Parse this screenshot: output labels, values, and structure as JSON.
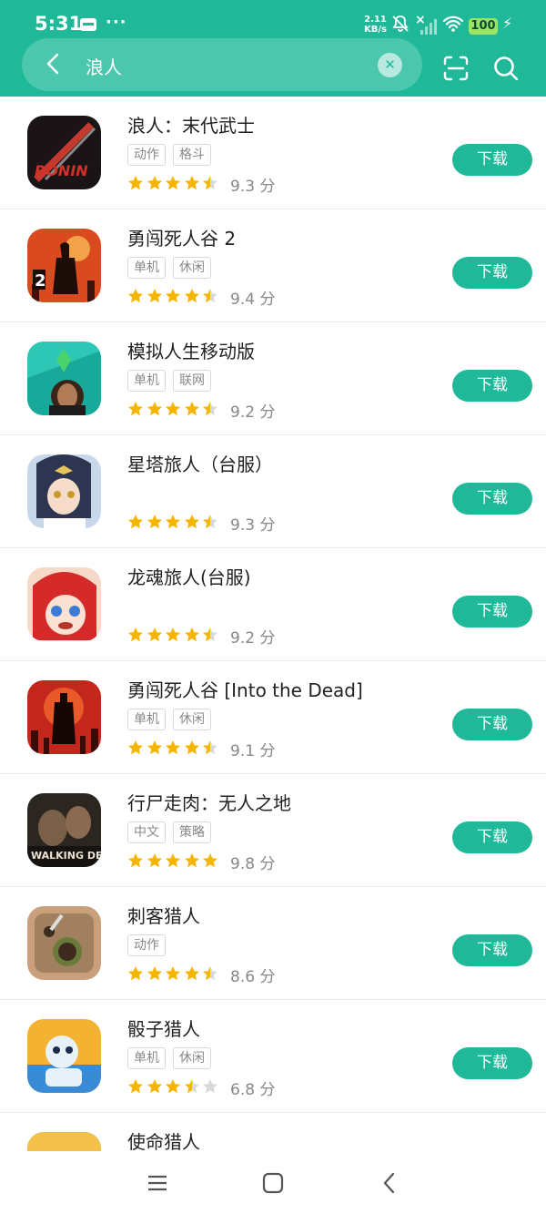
{
  "status": {
    "time": "5:31",
    "speed_value": "2.11",
    "speed_unit": "KB/s",
    "battery": "100"
  },
  "search": {
    "query": "浪人",
    "placeholder": ""
  },
  "accent": "#1fb99a",
  "download_label": "下载",
  "apps": [
    {
      "name": "浪人：末代武士",
      "tags": [
        "动作",
        "格斗"
      ],
      "rating": 4.5,
      "score": "9.3 分",
      "icon": "ronin-game-icon"
    },
    {
      "name": "勇闯死人谷 2",
      "tags": [
        "单机",
        "休闲"
      ],
      "rating": 4.5,
      "score": "9.4 分",
      "icon": "into-the-dead-2-icon"
    },
    {
      "name": "模拟人生移动版",
      "tags": [
        "单机",
        "联网"
      ],
      "rating": 4.5,
      "score": "9.2 分",
      "icon": "sims-mobile-icon"
    },
    {
      "name": "星塔旅人（台服）",
      "tags": [],
      "rating": 4.5,
      "score": "9.3 分",
      "icon": "star-tower-icon"
    },
    {
      "name": "龙魂旅人(台服)",
      "tags": [],
      "rating": 4.5,
      "score": "9.2 分",
      "icon": "dragon-soul-icon"
    },
    {
      "name": "勇闯死人谷 [Into the Dead]",
      "tags": [
        "单机",
        "休闲"
      ],
      "rating": 4.5,
      "score": "9.1 分",
      "icon": "into-the-dead-icon"
    },
    {
      "name": "行尸走肉：无人之地",
      "tags": [
        "中文",
        "策略"
      ],
      "rating": 5,
      "score": "9.8 分",
      "icon": "walking-dead-icon"
    },
    {
      "name": "刺客猎人",
      "tags": [
        "动作"
      ],
      "rating": 4.5,
      "score": "8.6 分",
      "icon": "hunter-assassin-icon"
    },
    {
      "name": "骰子猎人",
      "tags": [
        "单机",
        "休闲"
      ],
      "rating": 3.5,
      "score": "6.8 分",
      "icon": "dice-hunter-icon"
    },
    {
      "name": "使命猎人",
      "tags": [],
      "rating": 0,
      "score": "",
      "icon": "mission-hunter-icon"
    }
  ]
}
